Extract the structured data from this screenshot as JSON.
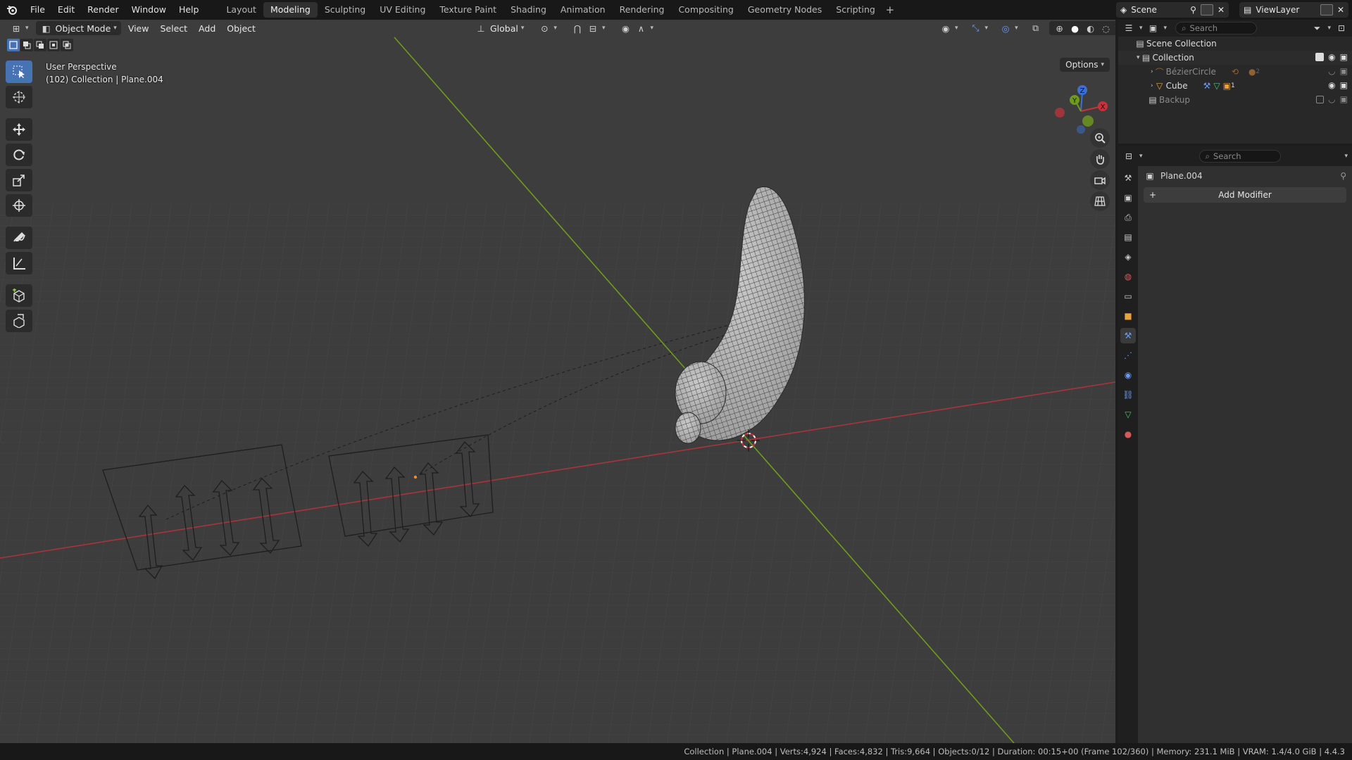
{
  "topbar": {
    "menus": [
      "File",
      "Edit",
      "Render",
      "Window",
      "Help"
    ],
    "workspaces": [
      "Layout",
      "Modeling",
      "Sculpting",
      "UV Editing",
      "Texture Paint",
      "Shading",
      "Animation",
      "Rendering",
      "Compositing",
      "Geometry Nodes",
      "Scripting"
    ],
    "active_workspace": "Modeling",
    "scene_name": "Scene",
    "view_layer": "ViewLayer"
  },
  "viewport": {
    "mode": "Object Mode",
    "menus": [
      "View",
      "Select",
      "Add",
      "Object"
    ],
    "orientation": "Global",
    "options_label": "Options",
    "perspective": "User Perspective",
    "collection_info": "(102) Collection | Plane.004",
    "gizmo_axes": {
      "x": "X",
      "y": "Y",
      "z": "Z"
    }
  },
  "outliner": {
    "search_placeholder": "Search",
    "scene_collection": "Scene Collection",
    "collection": "Collection",
    "items": [
      {
        "name": "BézierCircle",
        "dim": true
      },
      {
        "name": "Cube",
        "dim": false
      }
    ],
    "backup": "Backup",
    "cube_badge": "1",
    "bezier_badge": "2"
  },
  "properties": {
    "search_placeholder": "Search",
    "object_name": "Plane.004",
    "add_modifier": "Add Modifier"
  },
  "statusbar": {
    "text": "Collection | Plane.004 | Verts:4,924 | Faces:4,832 | Tris:9,664 | Objects:0/12 | Duration: 00:15+00 (Frame 102/360) | Memory: 231.1 MiB | VRAM: 1.4/4.0 GiB | 4.4.3"
  },
  "colors": {
    "accent": "#4772b3",
    "x_axis": "#a8343c",
    "y_axis": "#6f9a1e",
    "z_axis": "#3d6fd6"
  }
}
